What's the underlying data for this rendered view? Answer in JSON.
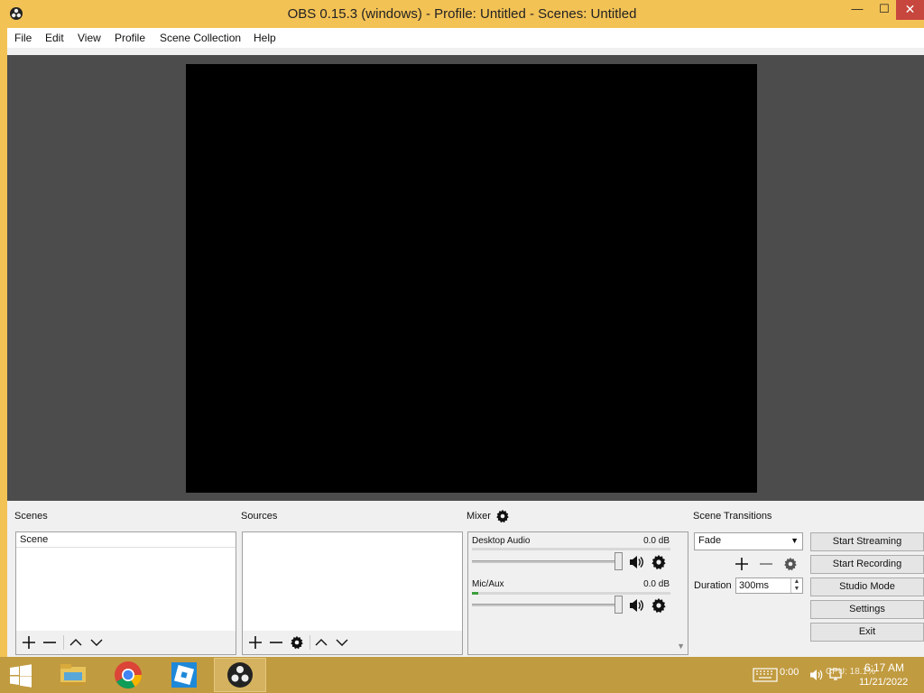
{
  "window": {
    "title": "OBS 0.15.3 (windows) - Profile: Untitled - Scenes: Untitled",
    "minimize": "—",
    "maximize": "☐",
    "close": "✕"
  },
  "menubar": {
    "items": [
      {
        "label": "File"
      },
      {
        "label": "Edit"
      },
      {
        "label": "View"
      },
      {
        "label": "Profile"
      },
      {
        "label": "Scene Collection"
      },
      {
        "label": "Help"
      }
    ]
  },
  "docks": {
    "scenes": {
      "label": "Scenes",
      "items": [
        "Scene"
      ]
    },
    "sources": {
      "label": "Sources",
      "items": []
    },
    "mixer": {
      "label": "Mixer",
      "channels": [
        {
          "name": "Desktop Audio",
          "db": "0.0 dB",
          "level": 0.0
        },
        {
          "name": "Mic/Aux",
          "db": "0.0 dB",
          "level": 0.03
        }
      ]
    },
    "transitions": {
      "label": "Scene Transitions",
      "selected": "Fade",
      "duration_label": "Duration",
      "duration_value": "300ms"
    }
  },
  "controls": {
    "start_streaming": "Start Streaming",
    "start_recording": "Start Recording",
    "studio_mode": "Studio Mode",
    "settings": "Settings",
    "exit": "Exit"
  },
  "taskbar": {
    "apps": [
      "file-explorer",
      "chrome",
      "roblox",
      "obs"
    ],
    "tray": {
      "cpu_text": "0:00",
      "cpu_text2": "CPU: 18.1%",
      "time": "6:17 AM",
      "date": "11/21/2022"
    }
  },
  "colors": {
    "frame": "#f3c255",
    "taskbar": "#c19b40",
    "preview_bg": "#4c4c4c",
    "close_red": "#c7463d"
  }
}
